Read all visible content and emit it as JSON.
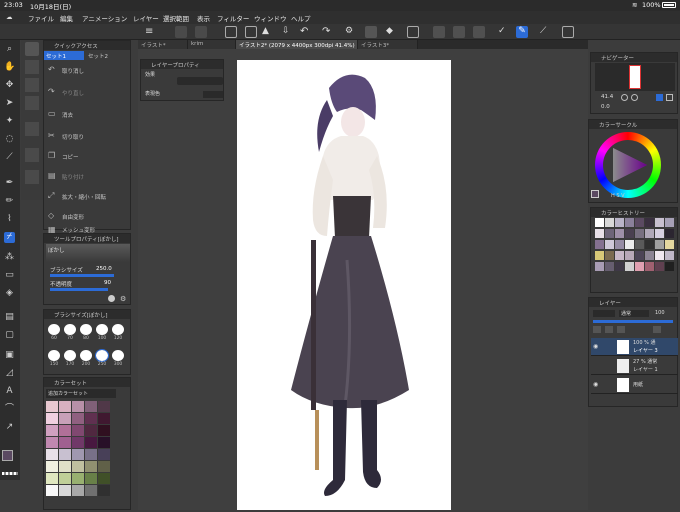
{
  "status": {
    "time": "23:03",
    "date": "10月18日(日)",
    "battery": "100%",
    "wifi_icon": "wifi-icon",
    "battery_icon": "battery-icon"
  },
  "menu": {
    "items": [
      "ファイル",
      "編集",
      "アニメーション",
      "レイヤー",
      "選択範囲",
      "表示",
      "フィルター",
      "ウィンドウ",
      "ヘルプ"
    ]
  },
  "tabs": [
    {
      "label": "イラスト*"
    },
    {
      "label": "krim"
    },
    {
      "label": "イラスト2* (2079 x 4400px 300dpi 41.4%)"
    },
    {
      "label": "イラスト3*"
    }
  ],
  "quick_access": {
    "title": "クイックアクセス",
    "sets": [
      "セット1",
      "セット2"
    ],
    "items": [
      "取り消し",
      "やり直し",
      "消去",
      "切り取り",
      "コピー",
      "貼り付け",
      "拡大・縮小・回転",
      "自由変形",
      "メッシュ変形"
    ]
  },
  "layer_property": {
    "title": "レイヤープロパティ",
    "effect_label": "効果",
    "color_label": "表現色"
  },
  "tool_property": {
    "title": "ツールプロパティ[ぼかし]",
    "tool_name": "ぼかし",
    "brush_size_label": "ブラシサイズ",
    "brush_size_value": "250.0",
    "opacity_label": "不透明度",
    "opacity_value": "90"
  },
  "brush_size_panel": {
    "title": "ブラシサイズ[ぼかし]",
    "sizes": [
      "60",
      "70",
      "80",
      "100",
      "120",
      "150",
      "170",
      "200",
      "250",
      "300"
    ]
  },
  "color_set": {
    "title": "カラーセット",
    "set_name": "追加カラーセット"
  },
  "navigator": {
    "title": "ナビゲーター",
    "zoom": "41.4",
    "rotation": "0.0"
  },
  "color_circle": {
    "title": "カラーサークル"
  },
  "color_history": {
    "title": "カラーヒストリー"
  },
  "layer_panel": {
    "title": "レイヤー",
    "blend_mode": "通常",
    "opacity": "100",
    "layers": [
      {
        "info": "100 % 通",
        "name": "レイヤー 3"
      },
      {
        "info": "27 % 通常",
        "name": "レイヤー 1"
      },
      {
        "info": "",
        "name": "用紙"
      }
    ]
  },
  "colors": {
    "accent": "#2c6bd6",
    "main_color": "#5b4a62",
    "sub_color": "#ffffff",
    "history": [
      "#ffffff",
      "#d8d8d8",
      "#b9b4c8",
      "#8a809a",
      "#5b4a62",
      "#3a3040",
      "#c8c0d0",
      "#a6a0b6",
      "#e8e0e8",
      "#6d6478",
      "#9e8fa8",
      "#4a4050",
      "#787080",
      "#b0a8b8",
      "#d6cfe0",
      "#2b2530",
      "#847090",
      "#cfc8d8",
      "#968ca4",
      "#ececec",
      "#5a5a5a",
      "#303030",
      "#a0a0a0",
      "#e4d8a0",
      "#d8c878",
      "#7a6a50",
      "#c8b8c8",
      "#b8a8b8",
      "#4c4456",
      "#8c8494",
      "#f0e8f0",
      "#c0b8c8",
      "#a89cb4",
      "#665e70",
      "#3e3846",
      "#d0d0d0",
      "#e0a0b0",
      "#a06070",
      "#604050",
      "#202020"
    ],
    "colorset": [
      "#e8c8d0",
      "#d8b0c0",
      "#b890a8",
      "#806078",
      "#503848",
      "#f0d0e0",
      "#c8a0b8",
      "#906080",
      "#603050",
      "#401830",
      "#d0a0c0",
      "#b07098",
      "#804870",
      "#502840",
      "#301020",
      "#c088b0",
      "#a06090",
      "#703868",
      "#481840",
      "#281028",
      "#e8e0e8",
      "#c8c0d0",
      "#a098b0",
      "#787088",
      "#484058",
      "#f0f0e0",
      "#e0e0c8",
      "#c0c0a0",
      "#909070",
      "#606048",
      "#e0e8c0",
      "#c0d098",
      "#98b070",
      "#688048",
      "#405028",
      "#f8f8f8",
      "#d8d8d8",
      "#a8a8a8",
      "#707070",
      "#303030"
    ]
  },
  "icons": {
    "hamburger": "menu-icon",
    "undo": "undo-icon",
    "redo": "redo-icon",
    "gear": "gear-icon"
  }
}
